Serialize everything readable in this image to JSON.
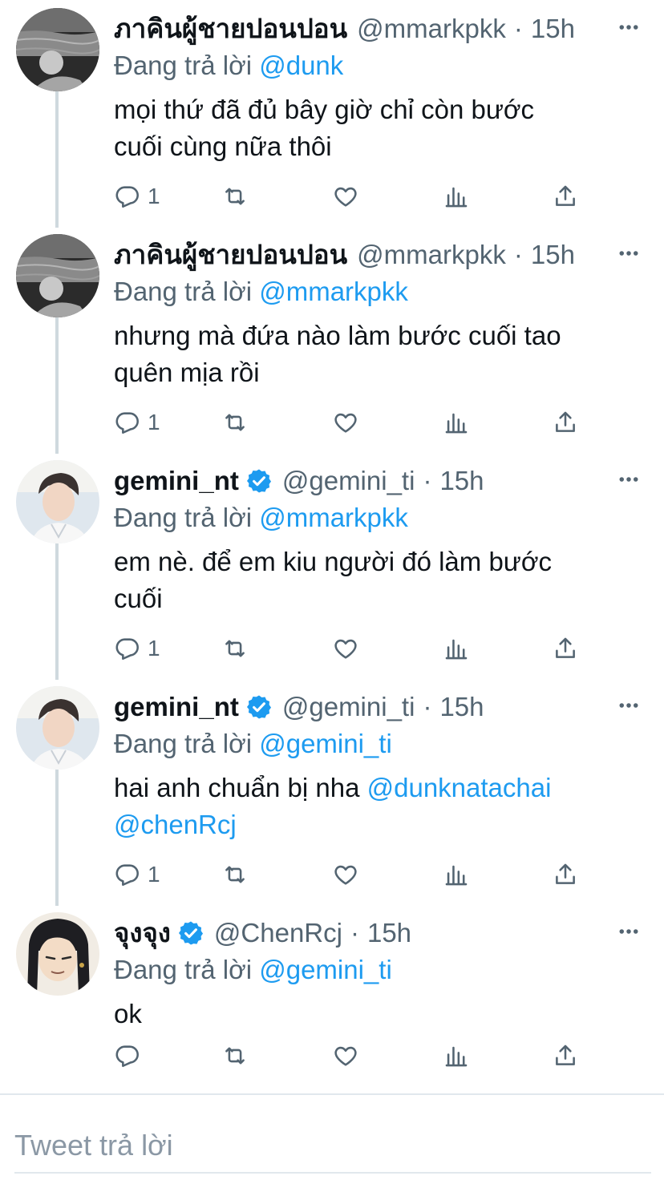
{
  "reply_prefix": "Đang trả lời",
  "compose": {
    "placeholder": "Tweet trả lời"
  },
  "tweets": [
    {
      "name": "ภาคินผู้ชายปอนปอน",
      "handle": "@mmarkpkk",
      "time": "15h",
      "reply_to": "@dunk",
      "text_lines": [
        "mọi thứ đã đủ bây giờ chỉ còn bước",
        "cuối cùng nữa thôi"
      ],
      "reply_count": "1",
      "verified": false
    },
    {
      "name": "ภาคินผู้ชายปอนปอน",
      "handle": "@mmarkpkk",
      "time": "15h",
      "reply_to": "@mmarkpkk",
      "text_lines": [
        "nhưng mà đứa nào làm bước cuối tao",
        "quên mịa rồi"
      ],
      "reply_count": "1",
      "verified": false
    },
    {
      "name": "gemini_nt",
      "handle": "@gemini_ti",
      "time": "15h",
      "reply_to": "@mmarkpkk",
      "text_lines": [
        "em nè. để em kiu người đó làm bước",
        "cuối"
      ],
      "reply_count": "1",
      "verified": true
    },
    {
      "name": "gemini_nt",
      "handle": "@gemini_ti",
      "time": "15h",
      "reply_to": "@gemini_ti",
      "text_prefix": "hai anh chuẩn bị nha ",
      "text_mention_1": "@dunknatachai",
      "text_mention_2": "@chenRcj",
      "reply_count": "1",
      "verified": true
    },
    {
      "name": "จุงจุง",
      "handle": "@ChenRcj",
      "time": "15h",
      "reply_to": "@gemini_ti",
      "text_lines": [
        "ok"
      ],
      "reply_count": "",
      "verified": true
    }
  ],
  "colors": {
    "accent": "#1d9bf0",
    "secondary_text": "#536471",
    "thread_line": "#cfd9de"
  },
  "icons": [
    "reply-icon",
    "retweet-icon",
    "like-icon",
    "stats-icon",
    "share-icon",
    "more-icon",
    "verified-badge-icon"
  ]
}
